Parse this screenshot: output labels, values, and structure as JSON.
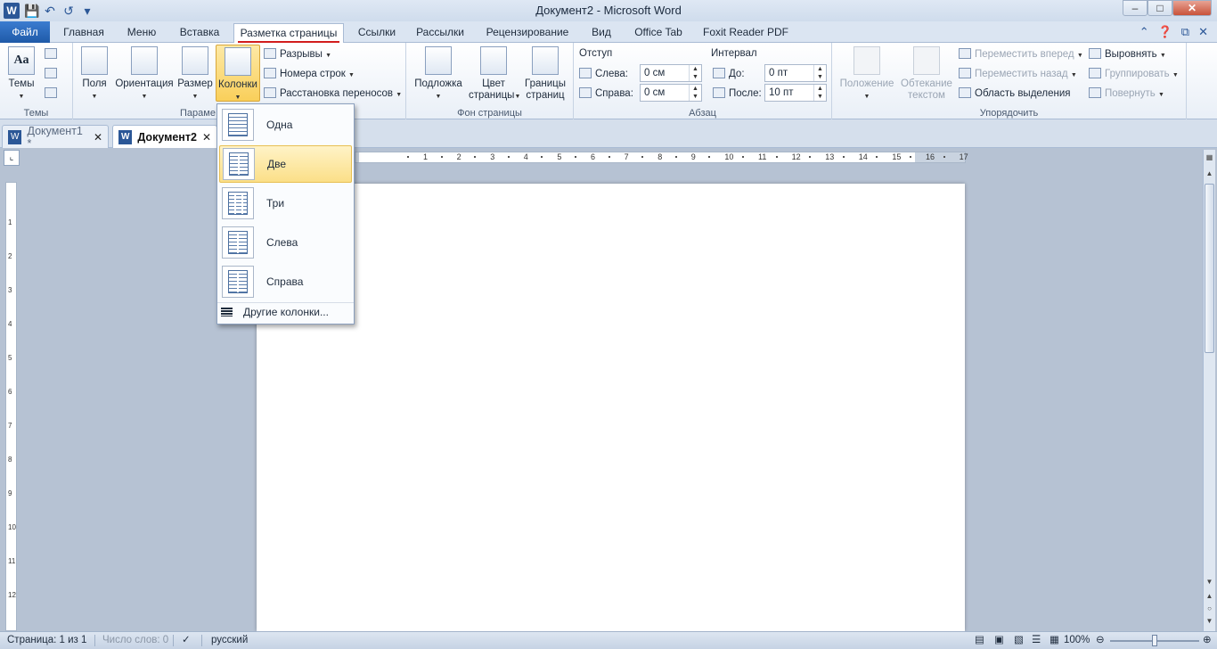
{
  "window": {
    "title": "Документ2 - Microsoft Word"
  },
  "qat": {
    "app_icon": "W",
    "icons": [
      "save-icon",
      "undo-icon",
      "redo-icon",
      "customize-icon"
    ]
  },
  "tabs": [
    {
      "label": "Файл"
    },
    {
      "label": "Главная"
    },
    {
      "label": "Меню"
    },
    {
      "label": "Вставка"
    },
    {
      "label": "Разметка страницы"
    },
    {
      "label": "Ссылки"
    },
    {
      "label": "Рассылки"
    },
    {
      "label": "Рецензирование"
    },
    {
      "label": "Вид"
    },
    {
      "label": "Office Tab"
    },
    {
      "label": "Foxit Reader PDF"
    }
  ],
  "ribbon": {
    "themes": {
      "label": "Темы",
      "group": "Темы"
    },
    "page_setup": {
      "fields": "Поля",
      "orientation": "Ориентация",
      "size": "Размер",
      "columns": "Колонки",
      "breaks": "Разрывы",
      "line_numbers": "Номера строк",
      "hyphenation": "Расстановка переносов",
      "group": "Парамe"
    },
    "background": {
      "watermark": "Подложка",
      "color_l1": "Цвет",
      "color_l2": "страницы",
      "borders_l1": "Границы",
      "borders_l2": "страниц",
      "group": "Фон страницы"
    },
    "paragraph": {
      "indent": "Отступ",
      "left": "Слева:",
      "left_val": "0 см",
      "right": "Справа:",
      "right_val": "0 см",
      "spacing": "Интервал",
      "before": "До:",
      "before_val": "0 пт",
      "after": "После:",
      "after_val": "10 пт",
      "group": "Абзац"
    },
    "arrange": {
      "position": "Положение",
      "wrap_l1": "Обтекание",
      "wrap_l2": "текстом",
      "forward": "Переместить вперед",
      "backward": "Переместить назад",
      "selection": "Область выделения",
      "align": "Выровнять",
      "group_btn": "Группировать",
      "rotate": "Повернуть",
      "group": "Упорядочить"
    }
  },
  "doc_tabs": [
    {
      "label": "Документ1 *"
    },
    {
      "label": "Документ2"
    }
  ],
  "columns_menu": {
    "items": [
      {
        "label": "Одна"
      },
      {
        "label": "Две"
      },
      {
        "label": "Три"
      },
      {
        "label": "Слева"
      },
      {
        "label": "Справа"
      }
    ],
    "more": "Другие колонки..."
  },
  "ruler": {
    "numbers": [
      "1",
      "2",
      "3",
      "4",
      "5",
      "6",
      "7",
      "8",
      "9",
      "10",
      "11",
      "12",
      "13",
      "14",
      "15",
      "16",
      "17"
    ]
  },
  "status": {
    "page": "Страница: 1 из 1",
    "words": "Число слов: 0",
    "lang": "русский",
    "zoom": "100%"
  },
  "zoom_level": 100
}
